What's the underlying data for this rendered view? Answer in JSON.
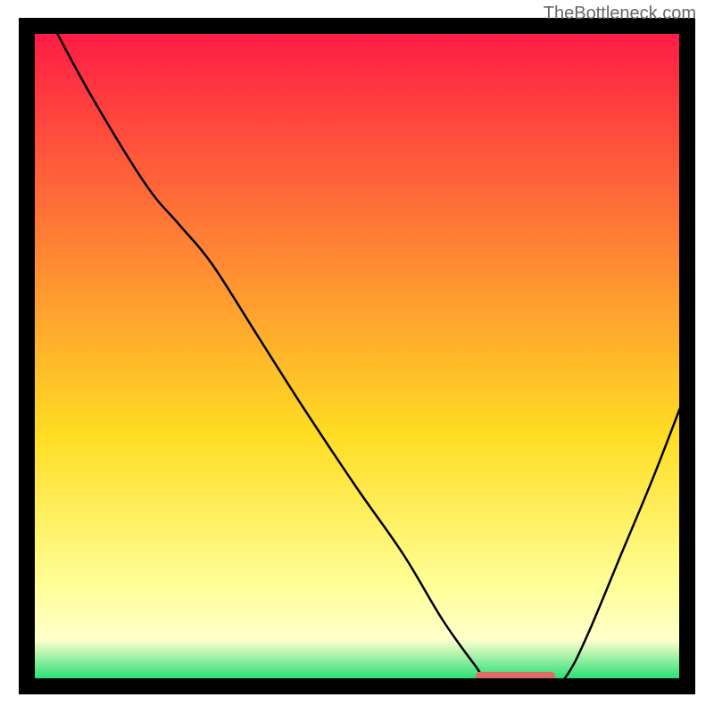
{
  "watermark": "TheBottleneck.com",
  "chart_data": {
    "type": "line",
    "title": "",
    "xlabel": "",
    "ylabel": "",
    "xlim": [
      0,
      100
    ],
    "ylim": [
      0,
      100
    ],
    "gradient_colors": {
      "top": "#ff1846",
      "mid1": "#ff8833",
      "mid2": "#ffdd22",
      "mid3": "#ffff99",
      "bottom": "#00d966"
    },
    "curve": [
      {
        "x": 4,
        "y": 100
      },
      {
        "x": 10,
        "y": 89
      },
      {
        "x": 18,
        "y": 76
      },
      {
        "x": 23,
        "y": 70
      },
      {
        "x": 28,
        "y": 64
      },
      {
        "x": 35,
        "y": 53
      },
      {
        "x": 42,
        "y": 42
      },
      {
        "x": 50,
        "y": 30
      },
      {
        "x": 57,
        "y": 20
      },
      {
        "x": 63,
        "y": 10
      },
      {
        "x": 68,
        "y": 3
      },
      {
        "x": 70,
        "y": 0.5
      },
      {
        "x": 75,
        "y": 0.5
      },
      {
        "x": 80,
        "y": 0.5
      },
      {
        "x": 82,
        "y": 2
      },
      {
        "x": 85,
        "y": 8
      },
      {
        "x": 90,
        "y": 20
      },
      {
        "x": 95,
        "y": 32
      },
      {
        "x": 100,
        "y": 45
      }
    ],
    "marker": {
      "x_start": 68,
      "x_end": 80,
      "y": 1.5,
      "color": "#dd6b66"
    },
    "frame_color": "#000000",
    "curve_color": "#000000"
  }
}
